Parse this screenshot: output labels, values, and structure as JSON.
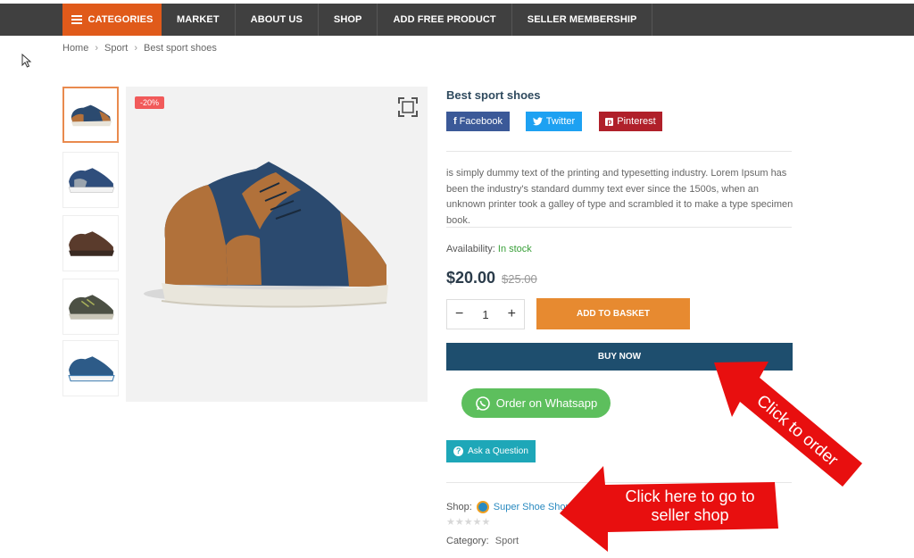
{
  "nav": {
    "categories_label": "CATEGORIES",
    "items": [
      "MARKET",
      "ABOUT US",
      "SHOP",
      "ADD FREE PRODUCT",
      "SELLER MEMBERSHIP"
    ]
  },
  "breadcrumb": [
    "Home",
    "Sport",
    "Best sport shoes"
  ],
  "gallery": {
    "discount_badge": "-20%"
  },
  "product": {
    "title": "Best sport shoes",
    "description": "is simply dummy text of the printing and typesetting industry. Lorem Ipsum has been the industry's standard dummy text ever since the 1500s, when an unknown printer took a galley of type and scrambled it to make a type specimen book.",
    "availability_label": "Availability:",
    "availability_value": "In stock",
    "price": "$20.00",
    "old_price": "$25.00",
    "quantity": "1",
    "add_to_basket": "ADD TO BASKET",
    "buy_now": "BUY NOW",
    "whatsapp": "Order on Whatsapp",
    "ask_question": "Ask a Question",
    "shop_label": "Shop:",
    "shop_name": "Super Shoe Shop",
    "category_label": "Category:",
    "category_value": "Sport"
  },
  "social": {
    "facebook": "Facebook",
    "twitter": "Twitter",
    "pinterest": "Pinterest"
  },
  "annotations": {
    "click_to_order": "Click to order",
    "seller_shop_line1": "Click here to go to",
    "seller_shop_line2": "seller shop"
  },
  "colors": {
    "nav_bg": "#404040",
    "categories_bg": "#e05a1a",
    "facebook": "#3b5998",
    "twitter": "#1da1f2",
    "pinterest": "#b0202a",
    "basket": "#e78a30",
    "buy_now": "#1e4e6e",
    "whatsapp": "#5dbf5d",
    "ask": "#1ea7b8",
    "arrow": "#e80f0f"
  },
  "icons": [
    "hamburger-icon",
    "chevron-right-icon",
    "expand-icon",
    "facebook-icon",
    "twitter-icon",
    "pinterest-icon",
    "minus-icon",
    "plus-icon",
    "whatsapp-icon",
    "question-icon",
    "shop-logo-icon",
    "star-icon",
    "mouse-cursor-icon"
  ]
}
